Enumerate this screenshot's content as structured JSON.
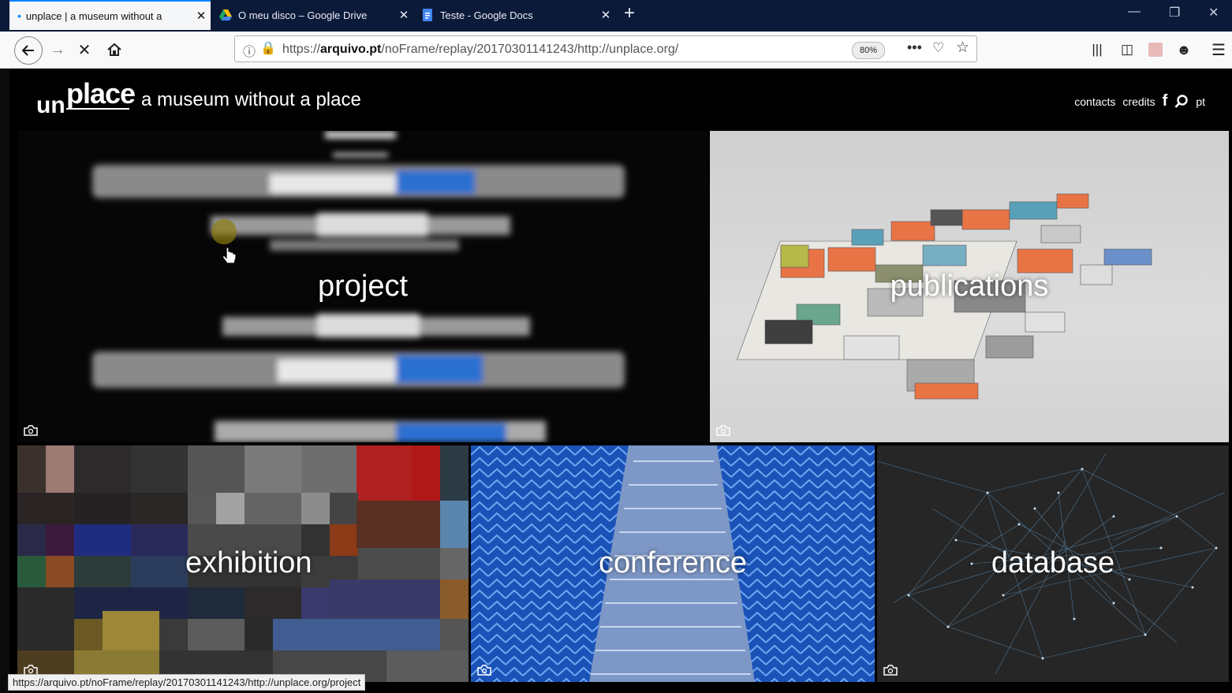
{
  "browser": {
    "tabs": [
      {
        "label": "unplace | a museum without a",
        "active": true,
        "icon": "dot-icon"
      },
      {
        "label": "O meu disco – Google Drive",
        "active": false,
        "icon": "google-drive-icon"
      },
      {
        "label": "Teste - Google Docs",
        "active": false,
        "icon": "google-docs-icon"
      }
    ],
    "url_prefix": "https://",
    "url_domain": "arquivo.pt",
    "url_rest": "/noFrame/replay/20170301141243/http://unplace.org/",
    "zoom": "80%",
    "status_url": "https://arquivo.pt/noFrame/replay/20170301141243/http://unplace.org/project"
  },
  "site": {
    "logo_up": "place",
    "logo_un": "un",
    "tagline": "a museum without a place",
    "nav": [
      "contacts",
      "credits"
    ],
    "lang": "pt",
    "tiles": [
      {
        "title": "project"
      },
      {
        "title": "publications"
      },
      {
        "title": "exhibition"
      },
      {
        "title": "conference"
      },
      {
        "title": "database"
      }
    ]
  },
  "colors": {
    "accent": "#0a84ff",
    "tabbar": "#0c1a3a"
  }
}
